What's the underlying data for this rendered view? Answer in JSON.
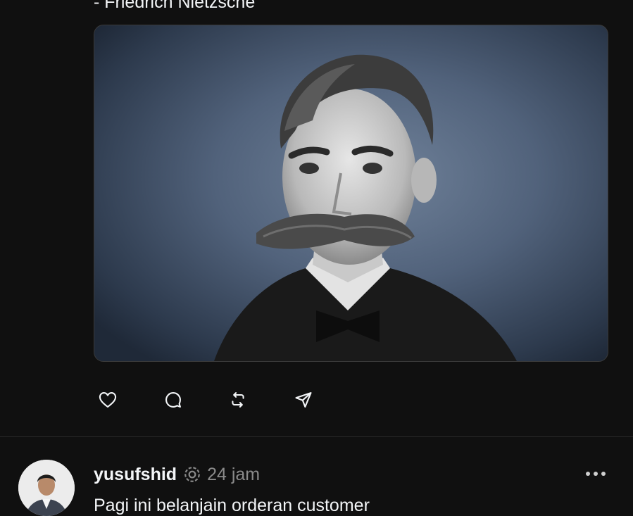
{
  "previous_post": {
    "quote_attribution": "- Friedrich Nietzsche",
    "image_alt": "Portrait of Friedrich Nietzsche",
    "actions": [
      {
        "name": "like",
        "icon": "heart-icon"
      },
      {
        "name": "reply",
        "icon": "comment-icon"
      },
      {
        "name": "repost",
        "icon": "repost-icon"
      },
      {
        "name": "share",
        "icon": "send-icon"
      }
    ]
  },
  "next_post": {
    "username": "yusufshid",
    "badge_icon": "threads-badge-icon",
    "timestamp": "24 jam",
    "text": "Pagi ini belanjain orderan customer",
    "more_icon": "more-options-icon"
  },
  "theme": {
    "background": "#101010",
    "text_primary": "#f3f5f7",
    "text_secondary": "#8a8a8a",
    "divider": "#2a2a2a"
  }
}
